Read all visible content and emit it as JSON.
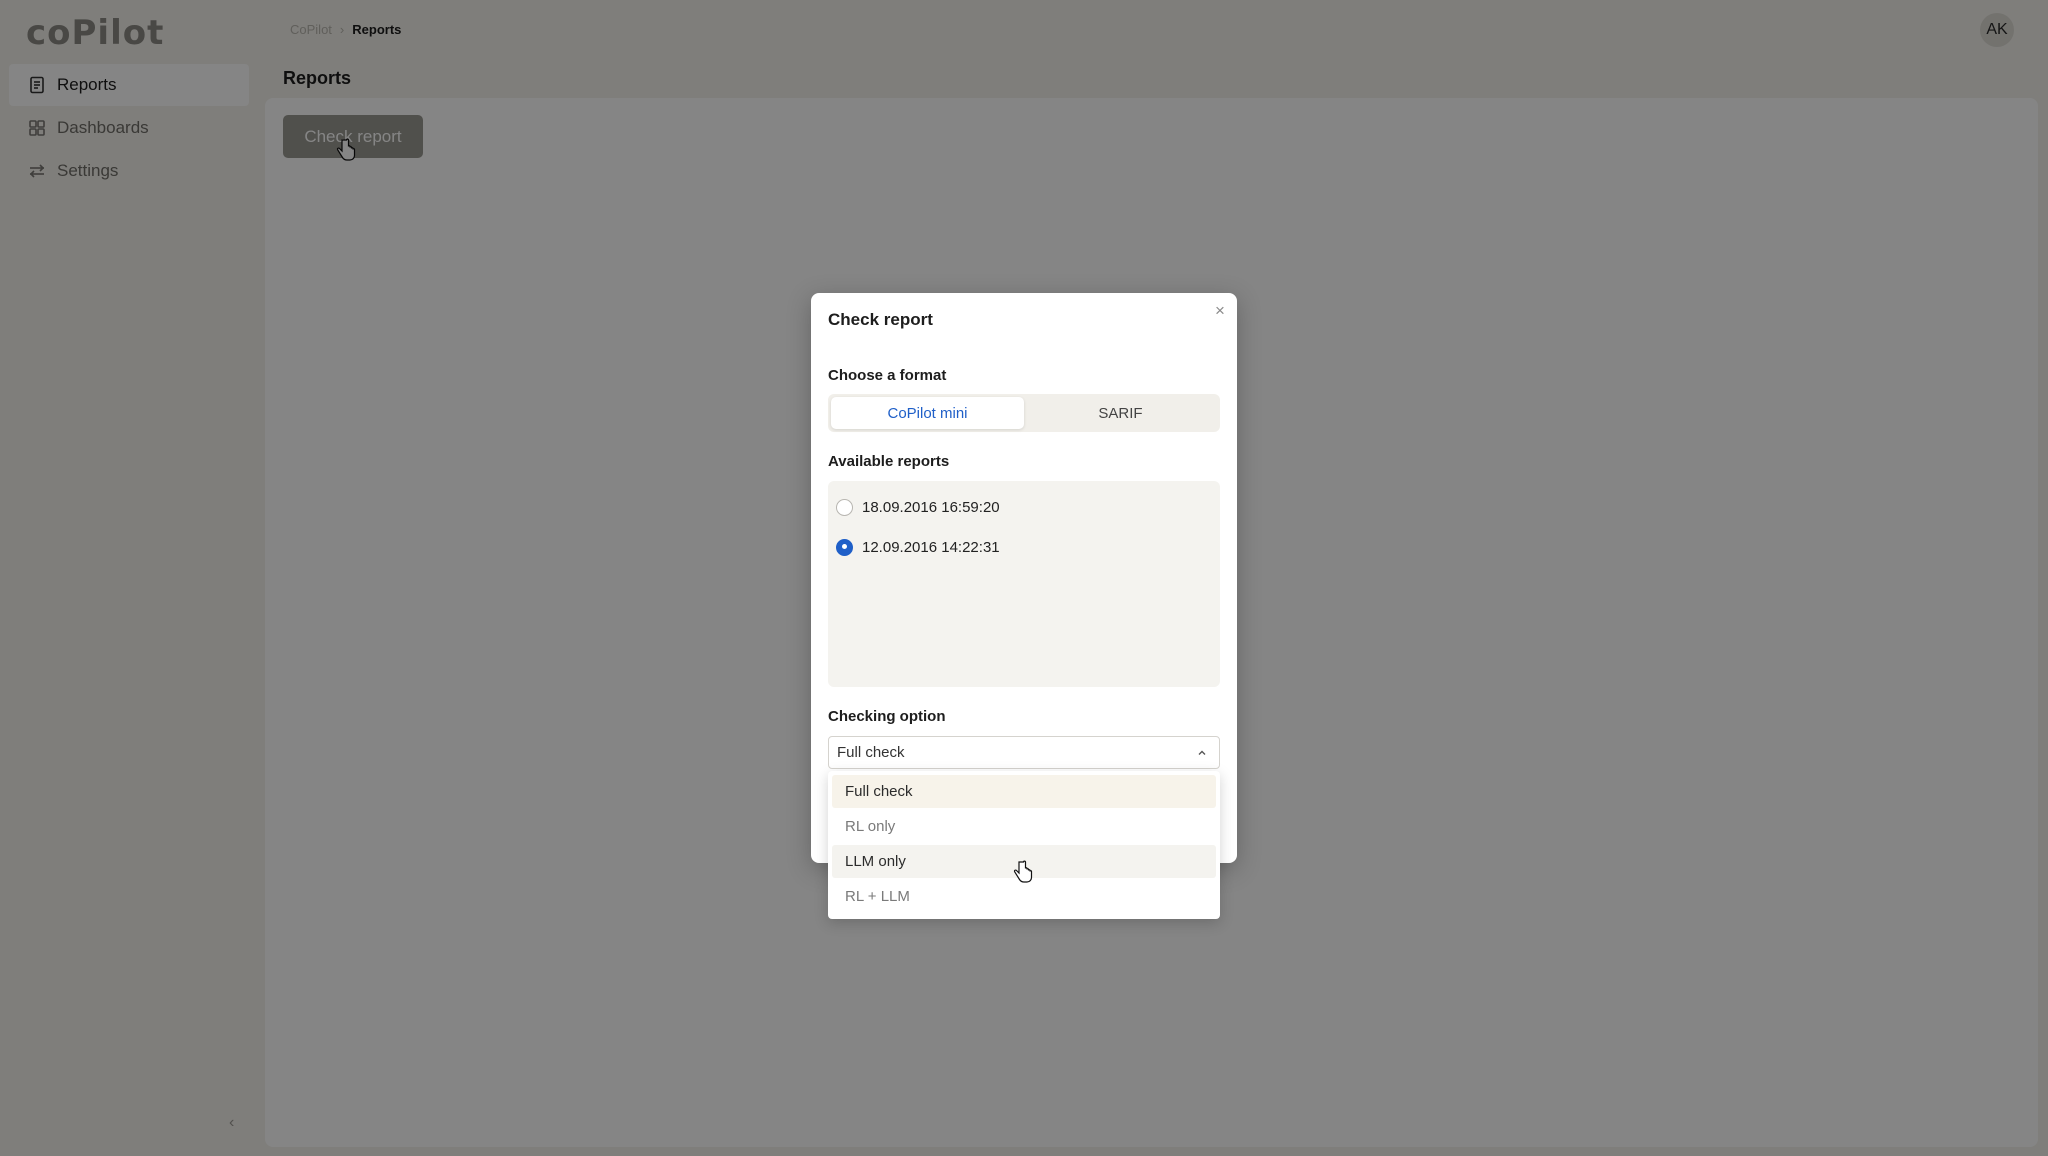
{
  "app": {
    "logo_text": "coPilot",
    "breadcrumb": {
      "parent": "CoPilot",
      "separator": "›",
      "current": "Reports"
    },
    "avatar_initials": "AK",
    "page_title": "Reports",
    "check_report_button": "Check report"
  },
  "sidebar": {
    "items": [
      {
        "label": "Reports",
        "icon": "document-icon",
        "active": true
      },
      {
        "label": "Dashboards",
        "icon": "grid-icon",
        "active": false
      },
      {
        "label": "Settings",
        "icon": "sliders-icon",
        "active": false
      }
    ],
    "collapse_icon": "chevron-left-icon"
  },
  "modal": {
    "title": "Check report",
    "close_icon": "close-icon",
    "format_label": "Choose a format",
    "formats": [
      {
        "label": "CoPilot mini",
        "selected": true
      },
      {
        "label": "SARIF",
        "selected": false
      }
    ],
    "reports_label": "Available reports",
    "reports": [
      {
        "label": "18.09.2016 16:59:20",
        "checked": false
      },
      {
        "label": "12.09.2016 14:22:31",
        "checked": true
      }
    ],
    "checking_label": "Checking option",
    "checking_value": "Full check",
    "options": [
      {
        "label": "Full check",
        "state": "selected"
      },
      {
        "label": "RL only",
        "state": "normal"
      },
      {
        "label": "LLM only",
        "state": "hover"
      },
      {
        "label": "RL + LLM",
        "state": "normal"
      }
    ]
  },
  "colors": {
    "accent": "#1f5fc8",
    "overlay": "rgba(0,0,0,0.48)",
    "page_bg": "#f3f1ec"
  }
}
